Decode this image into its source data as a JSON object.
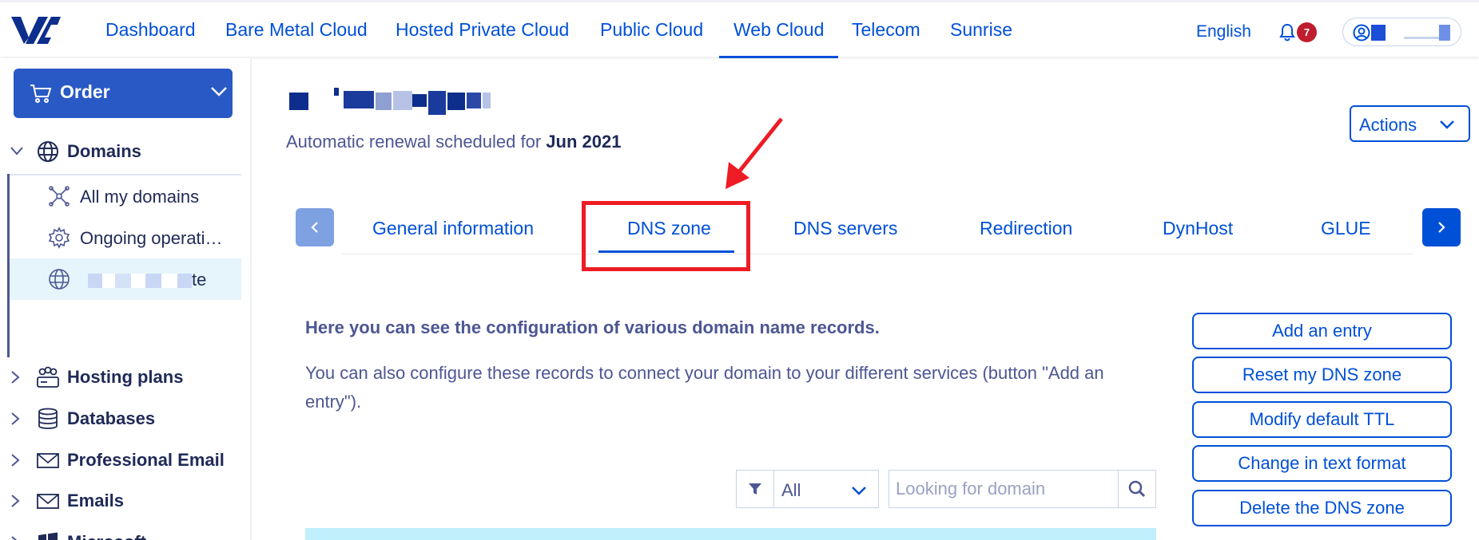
{
  "topnav": {
    "items": [
      {
        "label": "Dashboard"
      },
      {
        "label": "Bare Metal Cloud"
      },
      {
        "label": "Hosted Private Cloud"
      },
      {
        "label": "Public Cloud"
      },
      {
        "label": "Web Cloud",
        "active": true
      },
      {
        "label": "Telecom"
      },
      {
        "label": "Sunrise"
      }
    ],
    "language": "English",
    "notifications_count": "7"
  },
  "sidebar": {
    "order_label": "Order",
    "sections": [
      {
        "label": "Domains",
        "icon": "globe-icon",
        "expanded": true
      },
      {
        "label": "Hosting plans",
        "icon": "hosting-icon"
      },
      {
        "label": "Databases",
        "icon": "database-icon"
      },
      {
        "label": "Professional Email",
        "icon": "envelope-icon"
      },
      {
        "label": "Emails",
        "icon": "envelope-icon"
      },
      {
        "label": "Microsoft",
        "icon": "microsoft-icon"
      }
    ],
    "domain_items": [
      {
        "label": "All my domains",
        "icon": "network-icon"
      },
      {
        "label": "Ongoing operati…",
        "icon": "gear-icon"
      },
      {
        "label": "te",
        "icon": "globe-icon",
        "selected": true
      }
    ]
  },
  "main": {
    "renewal_prefix": "Automatic renewal scheduled for ",
    "renewal_date": "Jun 2021",
    "actions_label": "Actions",
    "tabs": [
      {
        "label": "General information"
      },
      {
        "label": "DNS zone",
        "active": true
      },
      {
        "label": "DNS servers"
      },
      {
        "label": "Redirection"
      },
      {
        "label": "DynHost"
      },
      {
        "label": "GLUE"
      }
    ],
    "desc_title": "Here you can see the configuration of various domain name records.",
    "desc_text": "You can also configure these records to connect your domain to your different services (button \"Add an entry\").",
    "buttons": [
      {
        "label": "Add an entry"
      },
      {
        "label": "Reset my DNS zone"
      },
      {
        "label": "Modify default TTL"
      },
      {
        "label": "Change in text format"
      },
      {
        "label": "Delete the DNS zone"
      }
    ],
    "filter_value": "All",
    "search_placeholder": "Looking for domain"
  },
  "colors": {
    "accent": "#0050d7",
    "text": "#4d5693",
    "highlight": "#ee1c24",
    "badge": "#bf1e2e"
  }
}
